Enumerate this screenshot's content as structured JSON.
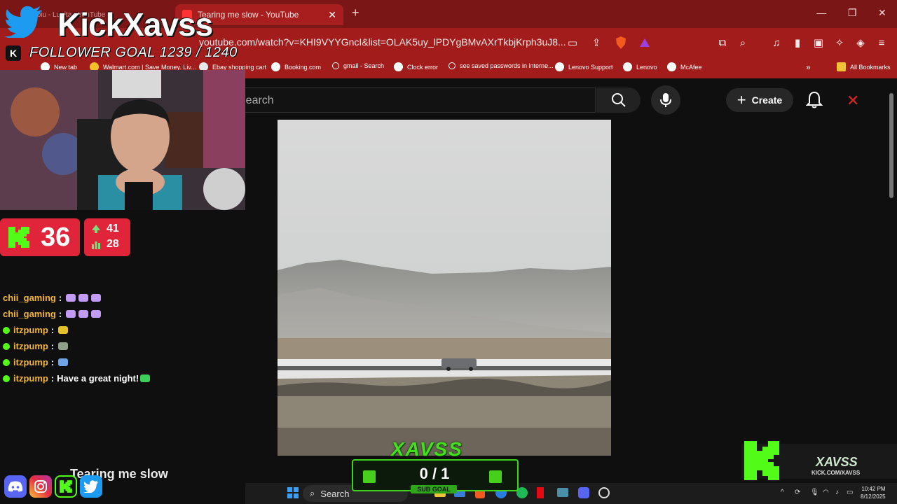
{
  "browser": {
    "active_tab_title": "Tearing me slow - YouTube",
    "inactive_tab_title": "Nebiu - Lupita - YouTube",
    "url": "youtube.com/watch?v=KHI9VYYGncI&list=OLAK5uy_lPDYgBMvAXrTkbjKrph3uJ8...",
    "bookmarks": [
      "New tab",
      "Walmart.com | Save Money. Liv...",
      "Ebay shopping cart",
      "Booking.com",
      "gmail - Search",
      "Clock error",
      "see saved passwords in interne...",
      "Lenovo Support",
      "Lenovo",
      "McAfee"
    ],
    "all_bookmarks": "All Bookmarks"
  },
  "youtube": {
    "search_placeholder": "Search",
    "create_label": "Create"
  },
  "overlay": {
    "brand": "KickXavss",
    "follower_goal": "FOLLOWER GOAL 1239 / 1240",
    "viewers": "36",
    "stat_up": "41",
    "stat_bars": "28",
    "now_playing": "Tearing me slow",
    "xavss_logo": "XAVSS",
    "sub_goal_count": "0 / 1",
    "sub_goal_label": "SUB GOAL",
    "kick_name": "XAVSS",
    "kick_url": "KICK.COM/XAVSS"
  },
  "chat": [
    {
      "badge": false,
      "user": "chii_gaming",
      "text": "",
      "emotes": [
        "#c39bf5",
        "#c39bf5",
        "#c39bf5"
      ]
    },
    {
      "badge": false,
      "user": "chii_gaming",
      "text": "",
      "emotes": [
        "#c39bf5",
        "#c39bf5",
        "#c39bf5"
      ]
    },
    {
      "badge": true,
      "user": "itzpump",
      "text": "",
      "emotes": [
        "#e6c12a"
      ]
    },
    {
      "badge": true,
      "user": "itzpump",
      "text": "",
      "emotes": [
        "#8ea08a"
      ]
    },
    {
      "badge": true,
      "user": "itzpump",
      "text": "",
      "emotes": [
        "#6fa3e8"
      ]
    },
    {
      "badge": true,
      "user": "itzpump",
      "text": "Have a great night!",
      "emotes": [
        "#3ccf5a"
      ]
    }
  ],
  "taskbar": {
    "search": "Search",
    "time": "10:42 PM",
    "date": "8/12/2025"
  },
  "colors": {
    "browser_chrome": "#a31c1c",
    "kick_green": "#53fc18",
    "counter_red": "#e0243a",
    "chat_username": "#f2b634"
  }
}
